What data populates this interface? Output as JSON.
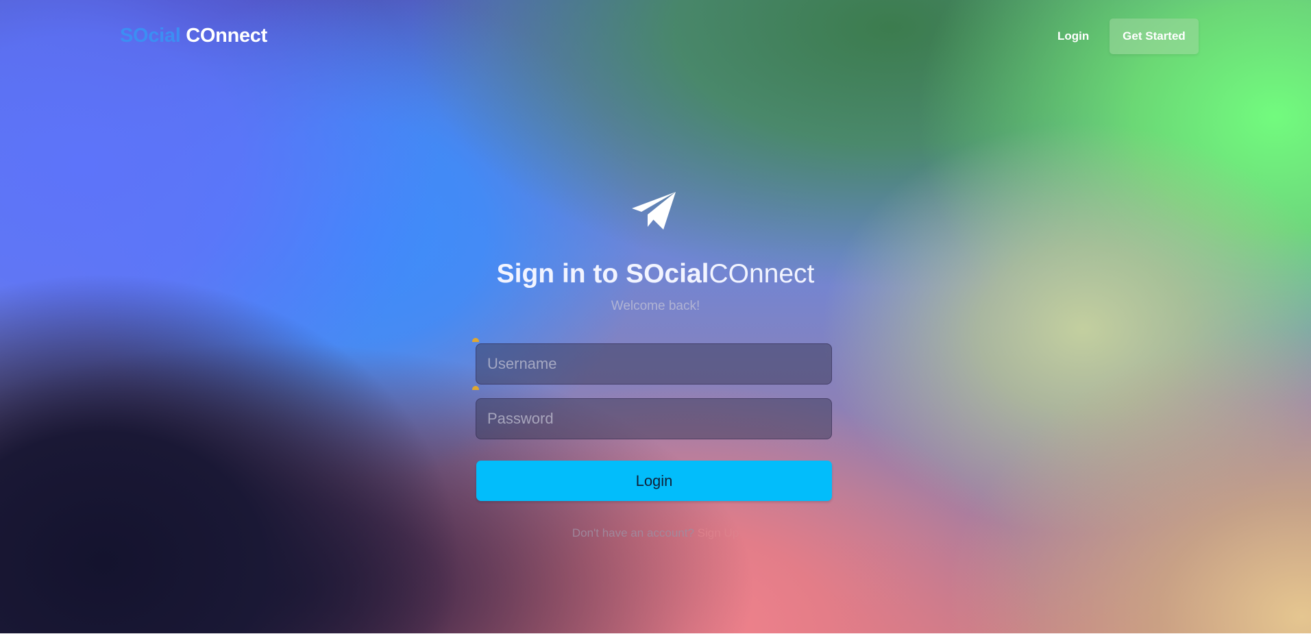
{
  "navbar": {
    "brand_part1": "SOcial",
    "brand_part2": "COnnect",
    "login_label": "Login",
    "get_started_label": "Get Started"
  },
  "hero": {
    "icon": "paper-plane-icon",
    "title_prefix": "Sign in to ",
    "title_brand_bold": "SOcial",
    "title_brand_light": "COnnect",
    "subtitle": "Welcome back!"
  },
  "form": {
    "username_placeholder": "Username",
    "username_value": "",
    "password_placeholder": "Password",
    "password_value": "",
    "submit_label": "Login",
    "signup_prompt": "Don't have an account? ",
    "signup_link": "Sign Up"
  },
  "colors": {
    "brand_accent": "#3c8ef3",
    "button": "#02bdfb",
    "hint_dot": "#e0a730"
  }
}
